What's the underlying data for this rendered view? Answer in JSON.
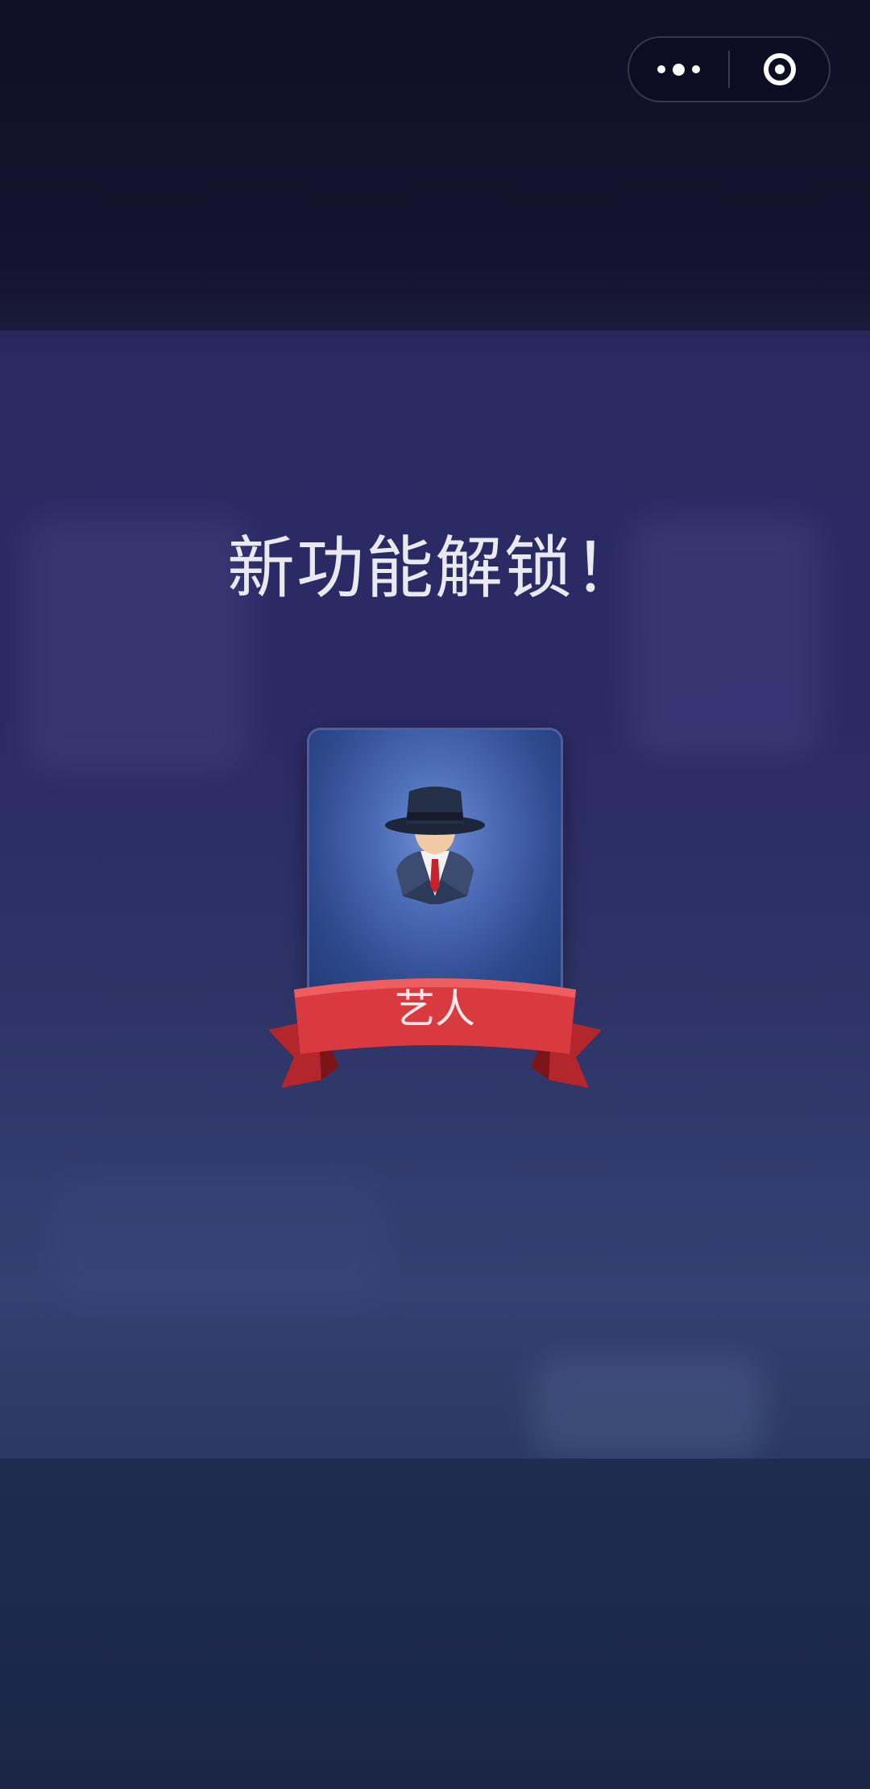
{
  "unlock": {
    "title": "新功能解锁！",
    "role_label": "艺人"
  },
  "capsule": {
    "menu_icon": "more-dots-icon",
    "close_icon": "target-circle-icon"
  },
  "colors": {
    "ribbon": "#d93a3f",
    "card": "#3a5aa6",
    "title_text": "#e9e9f1"
  }
}
